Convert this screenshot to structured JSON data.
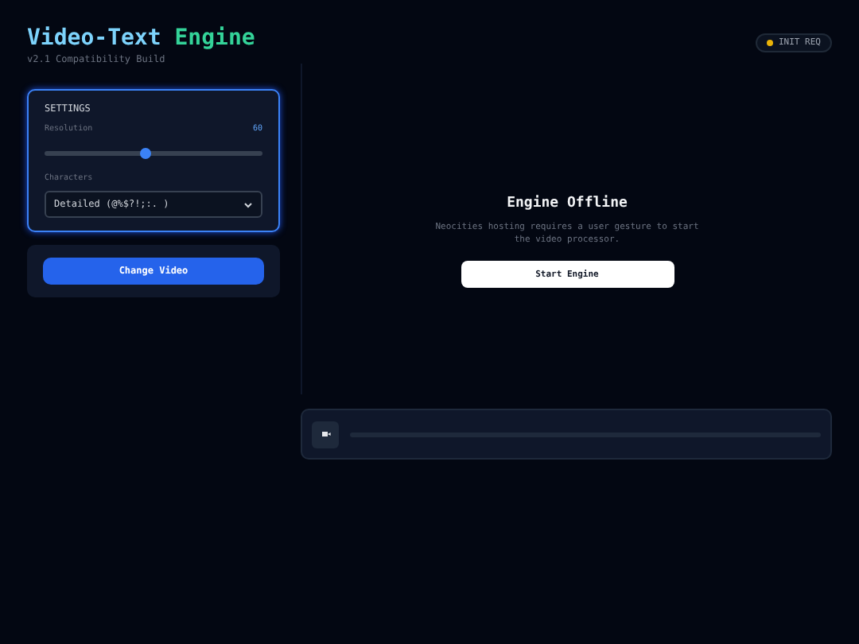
{
  "header": {
    "title_part_1": "Video-Text",
    "title_part_2": "Engine",
    "subtitle": "v2.1 Compatibility Build"
  },
  "status_badge": {
    "label": "INIT REQ",
    "color": "#eab308"
  },
  "settings": {
    "heading": "SETTINGS",
    "resolution": {
      "label": "Resolution",
      "reading": "60",
      "level": 0.46
    },
    "characters": {
      "label": "Characters",
      "value": "Detailed (@%$?!;:. )"
    }
  },
  "change_video_button": "Change Video",
  "display": {
    "title": "Engine Offline",
    "message": "Neocities hosting requires a user gesture to start the video processor.",
    "button": "Start Engine"
  },
  "playback": {
    "level": 0
  }
}
